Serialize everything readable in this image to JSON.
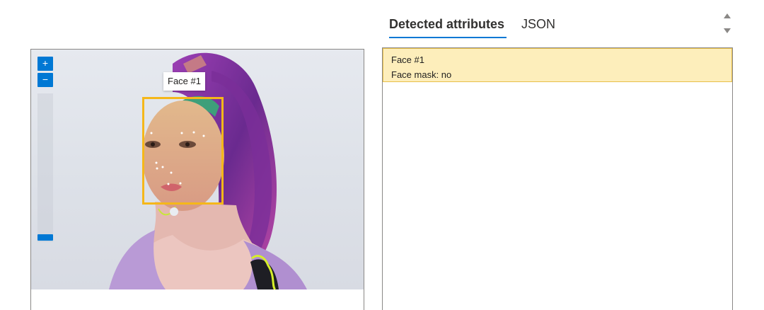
{
  "image_panel": {
    "zoom_in_label": "+",
    "zoom_out_label": "−",
    "face_tooltip": "Face #1"
  },
  "tabs": [
    {
      "label": "Detected attributes",
      "active": true
    },
    {
      "label": "JSON",
      "active": false
    }
  ],
  "results": {
    "items": [
      {
        "title": "Face #1",
        "attribute": "Face mask: no"
      }
    ]
  },
  "colors": {
    "accent": "#0078d4",
    "face_box": "#f5b71a",
    "selected_row_bg": "#fdeebb"
  }
}
